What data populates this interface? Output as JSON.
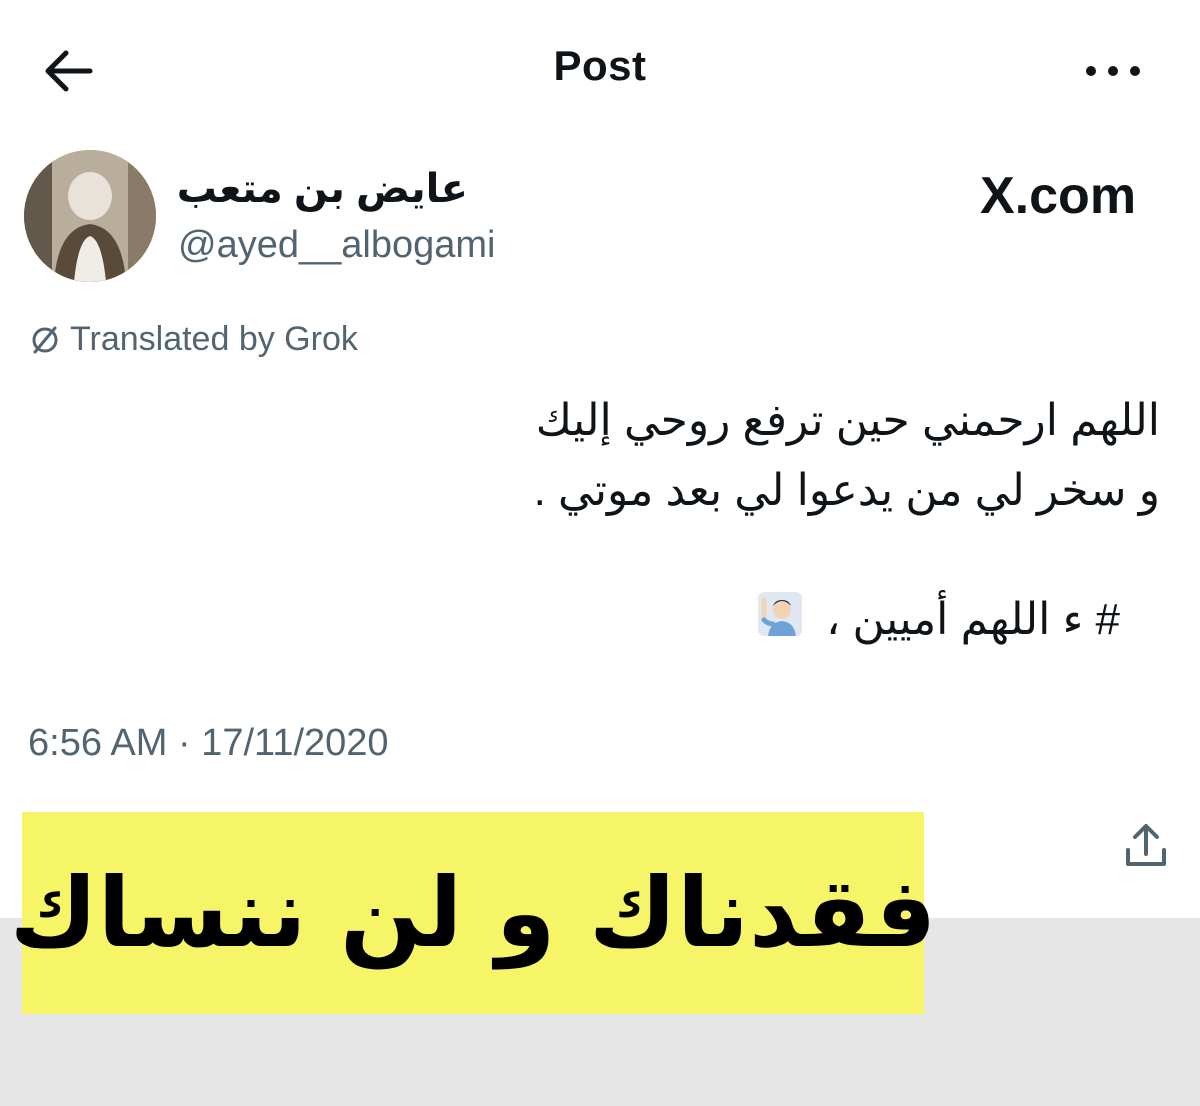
{
  "header": {
    "title": "Post",
    "back_icon": "arrow-left-icon",
    "more_icon": "more-horizontal-icon"
  },
  "author": {
    "display_name": "عايض بن متعب",
    "handle": "@ayed__albogami"
  },
  "brand": {
    "label": "X.com"
  },
  "translation": {
    "label": "Translated by Grok",
    "icon": "translate-icon"
  },
  "post": {
    "lines": [
      "اللهم ارحمني حين ترفع روحي إليك",
      "و سخر لي من يدعوا لي بعد موتي ."
    ],
    "hashtag_line": "# ء اللهم أميين ،",
    "emoji": "man-raising-hand-emoji"
  },
  "timestamp": "6:56 AM · 17/11/2020",
  "banner": {
    "text": "فقدناك و لن ننساك",
    "color": "#f6f467"
  },
  "actions": {
    "share_icon": "share-icon"
  },
  "colors": {
    "text": "#0f1419",
    "secondary": "#536471",
    "banner": "#f6f467"
  }
}
